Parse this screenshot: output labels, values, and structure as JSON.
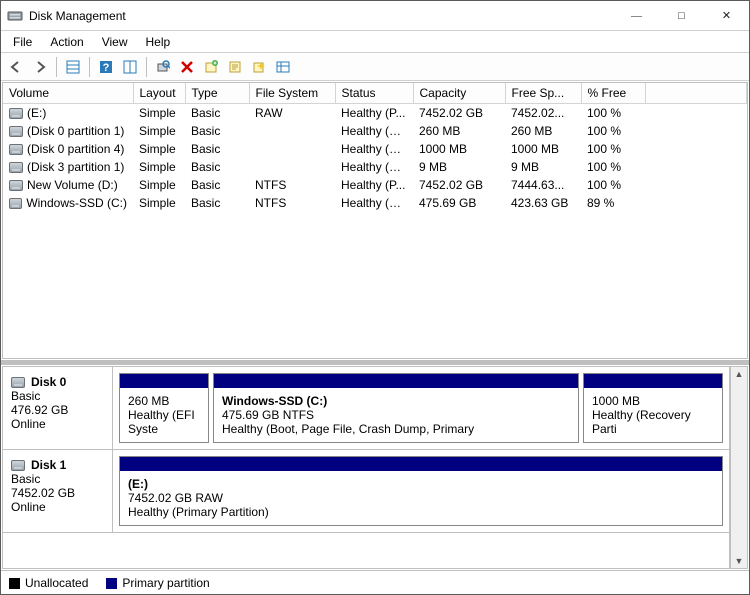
{
  "window": {
    "title": "Disk Management"
  },
  "menubar": [
    "File",
    "Action",
    "View",
    "Help"
  ],
  "columns": {
    "volume": "Volume",
    "layout": "Layout",
    "type": "Type",
    "fs": "File System",
    "status": "Status",
    "capacity": "Capacity",
    "free": "Free Sp...",
    "pct": "% Free"
  },
  "volumes": [
    {
      "volume": "(E:)",
      "layout": "Simple",
      "type": "Basic",
      "fs": "RAW",
      "status": "Healthy (P...",
      "capacity": "7452.02 GB",
      "free": "7452.02...",
      "pct": "100 %"
    },
    {
      "volume": "(Disk 0 partition 1)",
      "layout": "Simple",
      "type": "Basic",
      "fs": "",
      "status": "Healthy (E...",
      "capacity": "260 MB",
      "free": "260 MB",
      "pct": "100 %"
    },
    {
      "volume": "(Disk 0 partition 4)",
      "layout": "Simple",
      "type": "Basic",
      "fs": "",
      "status": "Healthy (R...",
      "capacity": "1000 MB",
      "free": "1000 MB",
      "pct": "100 %"
    },
    {
      "volume": "(Disk 3 partition 1)",
      "layout": "Simple",
      "type": "Basic",
      "fs": "",
      "status": "Healthy (E...",
      "capacity": "9 MB",
      "free": "9 MB",
      "pct": "100 %"
    },
    {
      "volume": "New Volume (D:)",
      "layout": "Simple",
      "type": "Basic",
      "fs": "NTFS",
      "status": "Healthy (P...",
      "capacity": "7452.02 GB",
      "free": "7444.63...",
      "pct": "100 %"
    },
    {
      "volume": "Windows-SSD (C:)",
      "layout": "Simple",
      "type": "Basic",
      "fs": "NTFS",
      "status": "Healthy (B...",
      "capacity": "475.69 GB",
      "free": "423.63 GB",
      "pct": "89 %"
    }
  ],
  "disks": [
    {
      "name": "Disk 0",
      "type": "Basic",
      "size": "476.92 GB",
      "status": "Online",
      "parts": [
        {
          "title": "",
          "line2": "260 MB",
          "line3": "Healthy (EFI Syste",
          "flex": "0 0 90px",
          "bold": false
        },
        {
          "title": "Windows-SSD  (C:)",
          "line2": "475.69 GB NTFS",
          "line3": "Healthy (Boot, Page File, Crash Dump, Primary",
          "flex": "1 1 auto",
          "bold": true
        },
        {
          "title": "",
          "line2": "1000 MB",
          "line3": "Healthy (Recovery Parti",
          "flex": "0 0 140px",
          "bold": false
        }
      ]
    },
    {
      "name": "Disk 1",
      "type": "Basic",
      "size": "7452.02 GB",
      "status": "Online",
      "parts": [
        {
          "title": "(E:)",
          "line2": "7452.02 GB RAW",
          "line3": "Healthy (Primary Partition)",
          "flex": "1 1 auto",
          "bold": true
        }
      ]
    }
  ],
  "legend": {
    "unallocated": "Unallocated",
    "primary": "Primary partition"
  }
}
